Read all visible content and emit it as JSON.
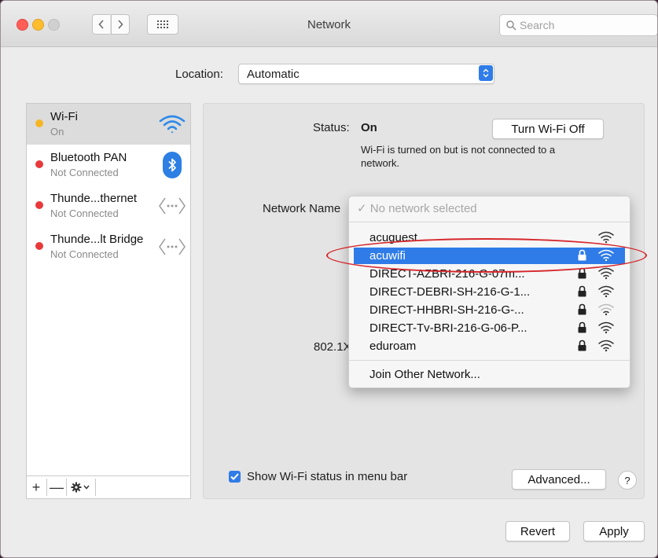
{
  "window": {
    "title": "Network"
  },
  "toolbar": {
    "search_placeholder": "Search"
  },
  "location": {
    "label": "Location:",
    "value": "Automatic"
  },
  "services": [
    {
      "name": "Wi-Fi",
      "status": "On",
      "dot_color": "#f5b625",
      "icon": "wifi-icon"
    },
    {
      "name": "Bluetooth PAN",
      "status": "Not Connected",
      "dot_color": "#e8393b",
      "icon": "bluetooth-icon"
    },
    {
      "name": "Thunde...thernet",
      "status": "Not Connected",
      "dot_color": "#e8393b",
      "icon": "thunderbolt-icon"
    },
    {
      "name": "Thunde...lt Bridge",
      "status": "Not Connected",
      "dot_color": "#e8393b",
      "icon": "thunderbolt-icon"
    }
  ],
  "sidebar_tools": {
    "add": "+",
    "remove": "—",
    "action": "action-gear-icon"
  },
  "detail": {
    "status_label": "Status:",
    "status_value": "On",
    "toggle_button": "Turn Wi-Fi Off",
    "status_description": "Wi-Fi is turned on but is not connected to a network.",
    "network_name_label": "Network Name",
    "dot1x_label": "802.1X"
  },
  "network_menu": {
    "none_label": "No network selected",
    "networks": [
      {
        "name": "acuguest",
        "locked": false,
        "selected": false
      },
      {
        "name": "acuwifi",
        "locked": true,
        "selected": true
      },
      {
        "name": "DIRECT-AZBRI-216-G-07m...",
        "locked": true,
        "selected": false
      },
      {
        "name": "DIRECT-DEBRI-SH-216-G-1...",
        "locked": true,
        "selected": false
      },
      {
        "name": "DIRECT-HHBRI-SH-216-G-...",
        "locked": true,
        "selected": false
      },
      {
        "name": "DIRECT-Tv-BRI-216-G-06-P...",
        "locked": true,
        "selected": false
      },
      {
        "name": "eduroam",
        "locked": true,
        "selected": false
      }
    ],
    "join_other": "Join Other Network..."
  },
  "show_status": {
    "label": "Show Wi-Fi status in menu bar",
    "checked": true
  },
  "buttons": {
    "advanced": "Advanced...",
    "help": "?",
    "revert": "Revert",
    "apply": "Apply"
  },
  "colors": {
    "accent": "#2f7ce8",
    "highlight_ellipse": "#d6262b"
  }
}
